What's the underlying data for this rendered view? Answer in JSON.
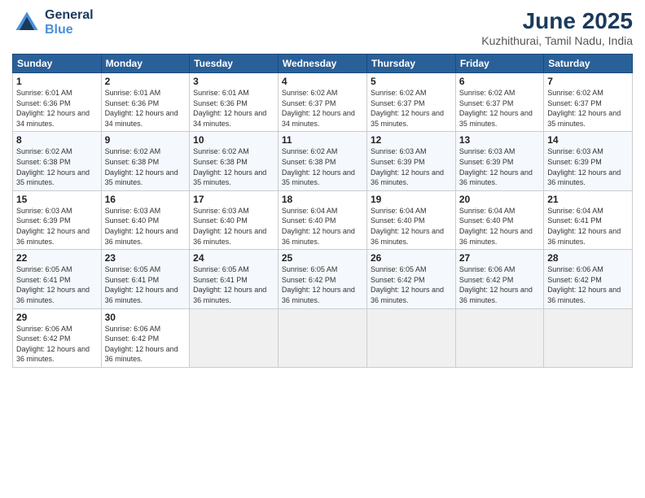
{
  "header": {
    "logo_line1": "General",
    "logo_line2": "Blue",
    "title": "June 2025",
    "subtitle": "Kuzhithurai, Tamil Nadu, India"
  },
  "days_of_week": [
    "Sunday",
    "Monday",
    "Tuesday",
    "Wednesday",
    "Thursday",
    "Friday",
    "Saturday"
  ],
  "weeks": [
    [
      {
        "day": "1",
        "sunrise": "6:01 AM",
        "sunset": "6:36 PM",
        "daylight": "12 hours and 34 minutes."
      },
      {
        "day": "2",
        "sunrise": "6:01 AM",
        "sunset": "6:36 PM",
        "daylight": "12 hours and 34 minutes."
      },
      {
        "day": "3",
        "sunrise": "6:01 AM",
        "sunset": "6:36 PM",
        "daylight": "12 hours and 34 minutes."
      },
      {
        "day": "4",
        "sunrise": "6:02 AM",
        "sunset": "6:37 PM",
        "daylight": "12 hours and 34 minutes."
      },
      {
        "day": "5",
        "sunrise": "6:02 AM",
        "sunset": "6:37 PM",
        "daylight": "12 hours and 35 minutes."
      },
      {
        "day": "6",
        "sunrise": "6:02 AM",
        "sunset": "6:37 PM",
        "daylight": "12 hours and 35 minutes."
      },
      {
        "day": "7",
        "sunrise": "6:02 AM",
        "sunset": "6:37 PM",
        "daylight": "12 hours and 35 minutes."
      }
    ],
    [
      {
        "day": "8",
        "sunrise": "6:02 AM",
        "sunset": "6:38 PM",
        "daylight": "12 hours and 35 minutes."
      },
      {
        "day": "9",
        "sunrise": "6:02 AM",
        "sunset": "6:38 PM",
        "daylight": "12 hours and 35 minutes."
      },
      {
        "day": "10",
        "sunrise": "6:02 AM",
        "sunset": "6:38 PM",
        "daylight": "12 hours and 35 minutes."
      },
      {
        "day": "11",
        "sunrise": "6:02 AM",
        "sunset": "6:38 PM",
        "daylight": "12 hours and 35 minutes."
      },
      {
        "day": "12",
        "sunrise": "6:03 AM",
        "sunset": "6:39 PM",
        "daylight": "12 hours and 36 minutes."
      },
      {
        "day": "13",
        "sunrise": "6:03 AM",
        "sunset": "6:39 PM",
        "daylight": "12 hours and 36 minutes."
      },
      {
        "day": "14",
        "sunrise": "6:03 AM",
        "sunset": "6:39 PM",
        "daylight": "12 hours and 36 minutes."
      }
    ],
    [
      {
        "day": "15",
        "sunrise": "6:03 AM",
        "sunset": "6:39 PM",
        "daylight": "12 hours and 36 minutes."
      },
      {
        "day": "16",
        "sunrise": "6:03 AM",
        "sunset": "6:40 PM",
        "daylight": "12 hours and 36 minutes."
      },
      {
        "day": "17",
        "sunrise": "6:03 AM",
        "sunset": "6:40 PM",
        "daylight": "12 hours and 36 minutes."
      },
      {
        "day": "18",
        "sunrise": "6:04 AM",
        "sunset": "6:40 PM",
        "daylight": "12 hours and 36 minutes."
      },
      {
        "day": "19",
        "sunrise": "6:04 AM",
        "sunset": "6:40 PM",
        "daylight": "12 hours and 36 minutes."
      },
      {
        "day": "20",
        "sunrise": "6:04 AM",
        "sunset": "6:40 PM",
        "daylight": "12 hours and 36 minutes."
      },
      {
        "day": "21",
        "sunrise": "6:04 AM",
        "sunset": "6:41 PM",
        "daylight": "12 hours and 36 minutes."
      }
    ],
    [
      {
        "day": "22",
        "sunrise": "6:05 AM",
        "sunset": "6:41 PM",
        "daylight": "12 hours and 36 minutes."
      },
      {
        "day": "23",
        "sunrise": "6:05 AM",
        "sunset": "6:41 PM",
        "daylight": "12 hours and 36 minutes."
      },
      {
        "day": "24",
        "sunrise": "6:05 AM",
        "sunset": "6:41 PM",
        "daylight": "12 hours and 36 minutes."
      },
      {
        "day": "25",
        "sunrise": "6:05 AM",
        "sunset": "6:42 PM",
        "daylight": "12 hours and 36 minutes."
      },
      {
        "day": "26",
        "sunrise": "6:05 AM",
        "sunset": "6:42 PM",
        "daylight": "12 hours and 36 minutes."
      },
      {
        "day": "27",
        "sunrise": "6:06 AM",
        "sunset": "6:42 PM",
        "daylight": "12 hours and 36 minutes."
      },
      {
        "day": "28",
        "sunrise": "6:06 AM",
        "sunset": "6:42 PM",
        "daylight": "12 hours and 36 minutes."
      }
    ],
    [
      {
        "day": "29",
        "sunrise": "6:06 AM",
        "sunset": "6:42 PM",
        "daylight": "12 hours and 36 minutes."
      },
      {
        "day": "30",
        "sunrise": "6:06 AM",
        "sunset": "6:42 PM",
        "daylight": "12 hours and 36 minutes."
      },
      null,
      null,
      null,
      null,
      null
    ]
  ]
}
